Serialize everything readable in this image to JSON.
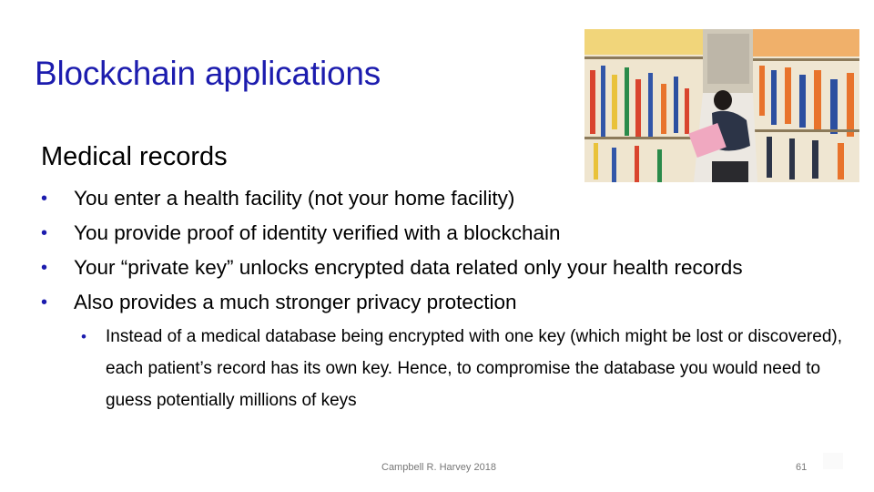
{
  "slide": {
    "title": "Blockchain applications",
    "subtitle": "Medical records",
    "image": {
      "description": "photo-of-medical-records-filing-room",
      "colors": {
        "folders_cream": "#efe6d2",
        "tabs_orange": "#e8732c",
        "tabs_blue": "#2c4fa0",
        "tabs_yellow": "#e9c23a",
        "uniform": "#2c3447",
        "folder_pink": "#f0a8c0"
      }
    },
    "bullets": [
      "You enter a health facility (not your home facility)",
      "You provide proof of identity verified with a blockchain",
      "Your “private key” unlocks encrypted data related only your health records",
      "Also provides a much stronger privacy protection"
    ],
    "sub_bullets": [
      "Instead of a medical database being encrypted with one key (which might be lost or discovered), each patient’s record has its own key. Hence, to compromise the database you would need to guess potentially millions of keys"
    ],
    "bullet_glyph": "•",
    "footer": {
      "author": "Campbell R. Harvey 2018",
      "page_number": "61"
    },
    "colors": {
      "title": "#1c1cae",
      "bullet": "#1c1cae",
      "text": "#000000",
      "footer": "#777777"
    }
  }
}
